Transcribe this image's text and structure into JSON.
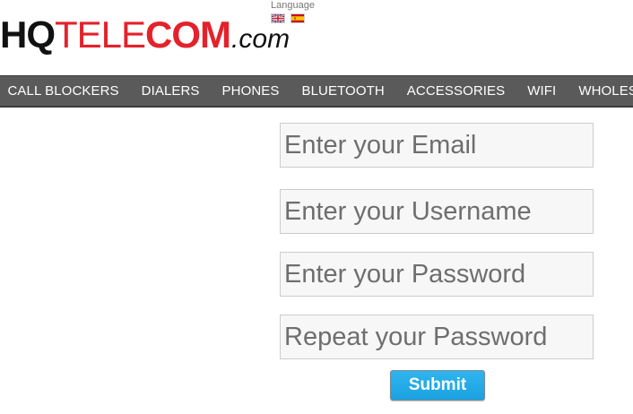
{
  "header": {
    "logo": {
      "hq": "HQ",
      "tele": "TELE",
      "com": "COM",
      "dotcom": ".com"
    },
    "language": {
      "label": "Language",
      "flags": [
        {
          "name": "uk-flag-icon"
        },
        {
          "name": "spain-flag-icon"
        }
      ]
    }
  },
  "nav": {
    "items": [
      {
        "label": "CALL BLOCKERS"
      },
      {
        "label": "DIALERS"
      },
      {
        "label": "PHONES"
      },
      {
        "label": "BLUETOOTH"
      },
      {
        "label": "ACCESSORIES"
      },
      {
        "label": "WIFI"
      },
      {
        "label": "WHOLESA"
      }
    ]
  },
  "form": {
    "email": {
      "value": "",
      "placeholder": "Enter your Email"
    },
    "username": {
      "value": "",
      "placeholder": "Enter your Username"
    },
    "password": {
      "value": "",
      "placeholder": "Enter your Password"
    },
    "repeat_password": {
      "value": "",
      "placeholder": "Repeat your Password"
    },
    "submit_label": "Submit"
  },
  "colors": {
    "brand_red": "#e3222b",
    "nav_bg": "#5a5a5a",
    "submit_blue": "#1aa2e0"
  }
}
